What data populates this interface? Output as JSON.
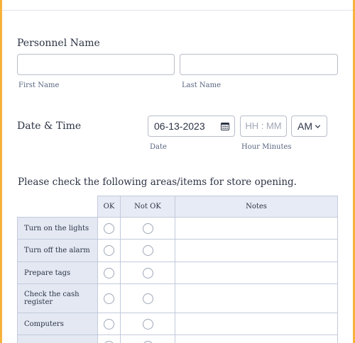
{
  "form": {
    "personnel": {
      "label": "Personnel Name",
      "first_name_value": "",
      "last_name_value": "",
      "first_sublabel": "First Name",
      "last_sublabel": "Last Name"
    },
    "datetime": {
      "label": "Date & Time",
      "date_value": "06-13-2023",
      "time_placeholder": "HH : MM",
      "ampm_value": "AM",
      "date_sublabel": "Date",
      "time_sublabel": "Hour Minutes",
      "calendar_icon": "calendar-icon",
      "select_icon": "chevron-down-icon"
    },
    "checklist": {
      "question": "Please check the following areas/items for store opening.",
      "columns": [
        "OK",
        "Not OK",
        "Notes"
      ],
      "rows": [
        "Turn on the lights",
        "Turn off the alarm",
        "Prepare tags",
        "Check the cash register",
        "Computers",
        ""
      ]
    }
  },
  "colors": {
    "page_background": "#f7b23b",
    "header_fill": "#e7ebf5",
    "row_label_fill": "#e3e8f3",
    "border": "#c3cadb"
  }
}
